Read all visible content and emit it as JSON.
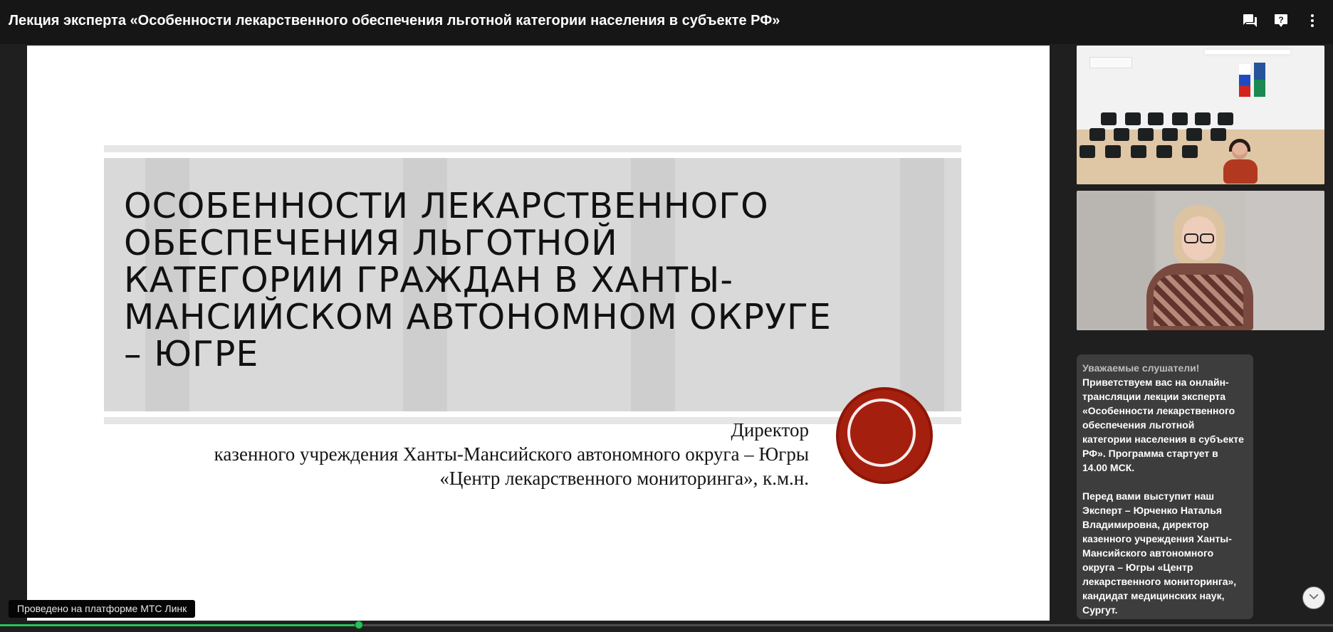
{
  "header": {
    "title": "Лекция эксперта «Особенности лекарственного обеспечения льготной категории населения в субъекте РФ»",
    "icons": [
      "chat-icon",
      "help-icon",
      "more-icon"
    ]
  },
  "slide": {
    "title": "ОСОБЕННОСТИ ЛЕКАРСТВЕННОГО ОБЕСПЕЧЕНИЯ ЛЬГОТНОЙ КАТЕГОРИИ ГРАЖДАН В ХАНТЫ-МАНСИЙСКОМ АВТОНОМНОМ ОКРУГЕ – ЮГРЕ",
    "speaker_line_1": "Директор",
    "speaker_line_2": "казенного учреждения Ханты-Мансийского автономного округа – Югры",
    "speaker_line_3": "«Центр лекарственного мониторинга», к.м.н."
  },
  "chat": {
    "heading": "Уважаемые слушатели!",
    "message": "Приветствуем вас на онлайн-\nтрансляции лекции эксперта\n«Особенности лекарственного\nобеспечения льготной\nкатегории населения в субъекте\nРФ». Программа стартует в\n14.00 МСК.\n\nПеред вами выступит наш\nЭксперт – Юрченко Наталья\nВладимировна, директор\nказенного учреждения Ханты-\nМансийского автономного\nокруга – Югры «Центр\nлекарственного мониторинга»,\nкандидат медицинских наук,\nСургут."
  },
  "footer": {
    "platform_label": "Проведено на платформе МТС Линк"
  },
  "player": {
    "progress": 0.269,
    "accent_color": "#29bf59"
  },
  "theme": {
    "background": "#1f1f1f",
    "chat_background": "#3d3d3d",
    "seal_color": "#a51f0f"
  }
}
